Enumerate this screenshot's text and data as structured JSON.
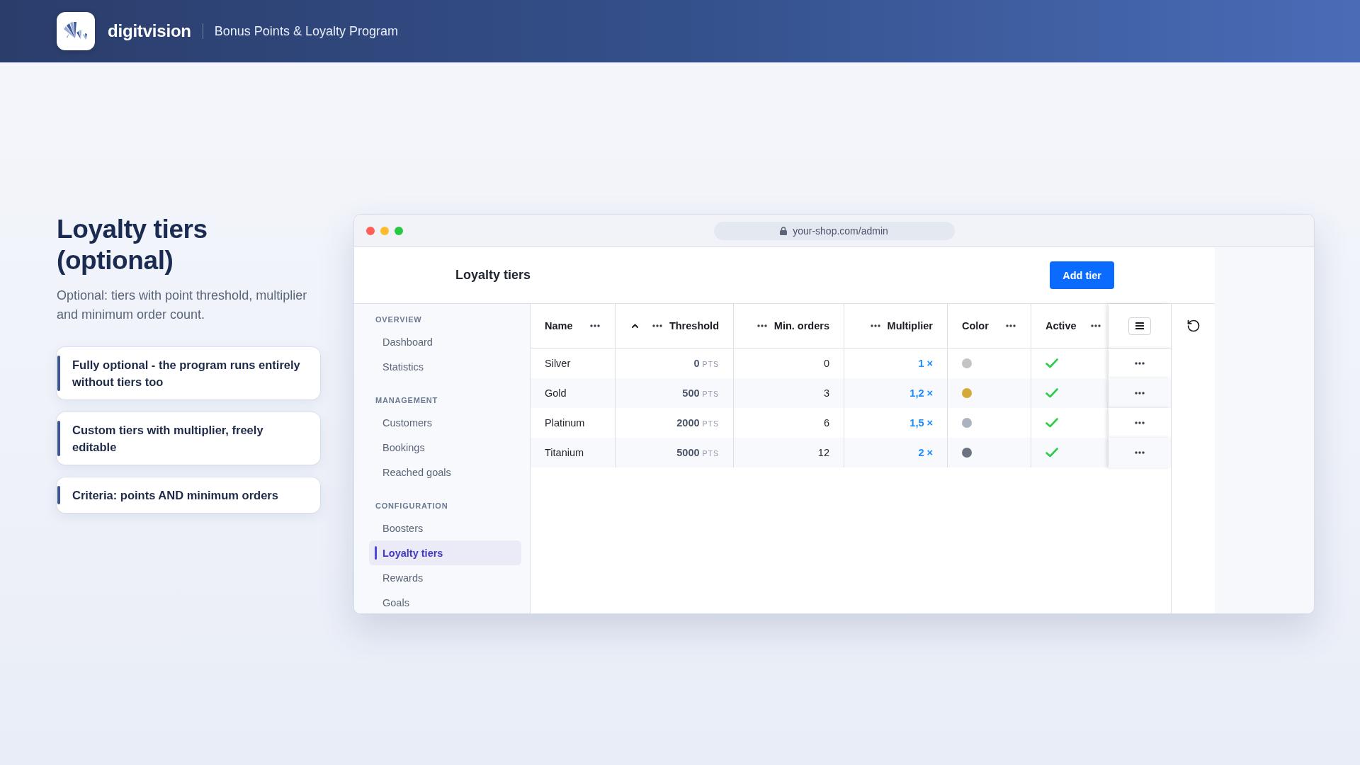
{
  "header": {
    "brand": "digitvision",
    "product": "Bonus Points & Loyalty Program"
  },
  "intro": {
    "title": "Loyalty tiers (optional)",
    "subtitle": "Optional: tiers with point threshold, multiplier and minimum order count.",
    "features": [
      "Fully optional - the program runs entirely without tiers too",
      "Custom tiers with multiplier, freely editable",
      "Criteria: points AND minimum orders"
    ]
  },
  "browser": {
    "url": "your-shop.com/admin"
  },
  "page": {
    "title": "Loyalty tiers",
    "primary_button": "Add tier"
  },
  "sidebar": {
    "sections": [
      {
        "label": "OVERVIEW",
        "items": [
          {
            "label": "Dashboard",
            "selected": false
          },
          {
            "label": "Statistics",
            "selected": false
          }
        ]
      },
      {
        "label": "MANAGEMENT",
        "items": [
          {
            "label": "Customers",
            "selected": false
          },
          {
            "label": "Bookings",
            "selected": false
          },
          {
            "label": "Reached goals",
            "selected": false
          }
        ]
      },
      {
        "label": "CONFIGURATION",
        "items": [
          {
            "label": "Boosters",
            "selected": false
          },
          {
            "label": "Loyalty tiers",
            "selected": true
          },
          {
            "label": "Rewards",
            "selected": false
          },
          {
            "label": "Goals",
            "selected": false
          }
        ]
      }
    ]
  },
  "table": {
    "columns": [
      {
        "label": "Name",
        "kind": "text",
        "sorted": false
      },
      {
        "label": "Threshold",
        "kind": "points",
        "sorted": true
      },
      {
        "label": "Min. orders",
        "kind": "count",
        "sorted": false
      },
      {
        "label": "Multiplier",
        "kind": "multiplier",
        "sorted": false
      },
      {
        "label": "Color",
        "kind": "color",
        "sorted": false
      },
      {
        "label": "Active",
        "kind": "check",
        "sorted": false
      }
    ],
    "rows": [
      {
        "name": "Silver",
        "threshold": "0",
        "unit": "PTS",
        "min_orders": "0",
        "multiplier": "1 ×",
        "color": "#c4c4c4",
        "active": true
      },
      {
        "name": "Gold",
        "threshold": "500",
        "unit": "PTS",
        "min_orders": "3",
        "multiplier": "1,2 ×",
        "color": "#d4a937",
        "active": true
      },
      {
        "name": "Platinum",
        "threshold": "2000",
        "unit": "PTS",
        "min_orders": "6",
        "multiplier": "1,5 ×",
        "color": "#aab3bf",
        "active": true
      },
      {
        "name": "Titanium",
        "threshold": "5000",
        "unit": "PTS",
        "min_orders": "12",
        "multiplier": "2 ×",
        "color": "#6b7380",
        "active": true
      }
    ]
  }
}
